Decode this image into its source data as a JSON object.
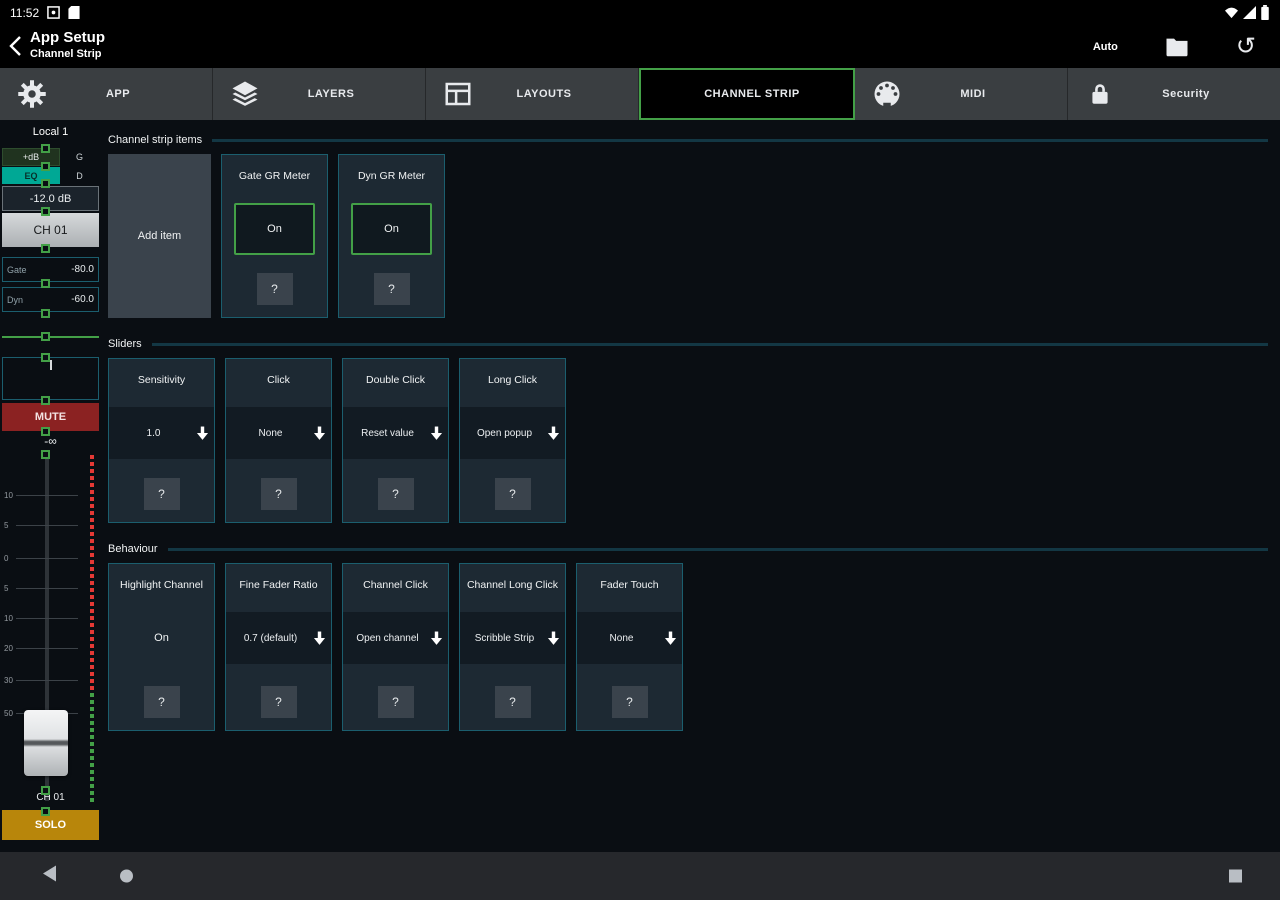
{
  "colors": {
    "accent_green": "#43a047",
    "card_border": "#1b5e6e",
    "mute_red": "#8b2222",
    "solo_amber": "#b8860b",
    "meter_red": "#e53935",
    "meter_green": "#43a047",
    "eq_teal": "#00a895"
  },
  "status_bar": {
    "time": "11:52"
  },
  "app_bar": {
    "title": "App Setup",
    "subtitle": "Channel Strip",
    "mode_label": "Auto"
  },
  "tabs": {
    "app": "APP",
    "layers": "LAYERS",
    "layouts": "LAYOUTS",
    "channel_strip": "CHANNEL STRIP",
    "midi": "MIDI",
    "security": "Security"
  },
  "preview": {
    "source": "Local 1",
    "gain_label": "+dB",
    "gate_abbr": "G",
    "eq_label": "EQ",
    "dyn_abbr": "D",
    "level": "-12.0 dB",
    "channel_name": "CH 01",
    "gate_label": "Gate",
    "gate_value": "-80.0",
    "dyn_label": "Dyn",
    "dyn_value": "-60.0",
    "mute_label": "MUTE",
    "fader_value": "-∞",
    "ticks": [
      "10",
      "5",
      "0",
      "5",
      "10",
      "20",
      "30",
      "50"
    ],
    "channel_name_bottom": "CH 01",
    "solo_label": "SOLO"
  },
  "sections": {
    "items": {
      "title": "Channel strip items",
      "add_item_label": "Add item",
      "cards": [
        {
          "title": "Gate GR Meter",
          "value": "On",
          "help": "?"
        },
        {
          "title": "Dyn GR Meter",
          "value": "On",
          "help": "?"
        }
      ]
    },
    "sliders": {
      "title": "Sliders",
      "cards": [
        {
          "title": "Sensitivity",
          "value": "1.0",
          "help": "?"
        },
        {
          "title": "Click",
          "value": "None",
          "help": "?"
        },
        {
          "title": "Double Click",
          "value": "Reset value",
          "help": "?"
        },
        {
          "title": "Long Click",
          "value": "Open popup",
          "help": "?"
        }
      ]
    },
    "behaviour": {
      "title": "Behaviour",
      "cards": [
        {
          "title": "Highlight Channel",
          "value": "On",
          "help": "?"
        },
        {
          "title": "Fine Fader Ratio",
          "value": "0.7 (default)",
          "help": "?"
        },
        {
          "title": "Channel Click",
          "value": "Open channel",
          "help": "?"
        },
        {
          "title": "Channel Long Click",
          "value": "Scribble Strip",
          "help": "?"
        },
        {
          "title": "Fader Touch",
          "value": "None",
          "help": "?"
        }
      ]
    }
  }
}
